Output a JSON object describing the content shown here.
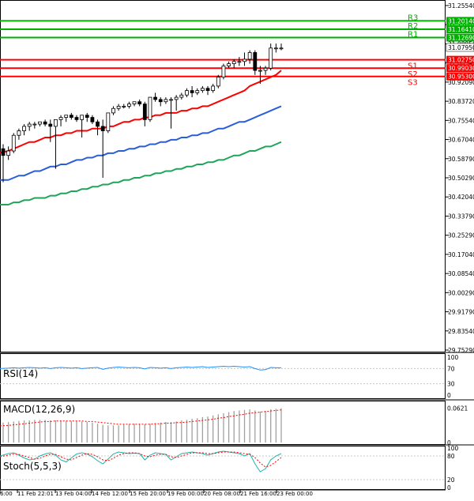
{
  "chart_data": [
    {
      "type": "candlestick",
      "panel": "price",
      "ylim": [
        29.73,
        31.27
      ],
      "y_ticks": [
        "31.25540",
        "31.17040",
        "31.08850",
        "31.00340",
        "30.92090",
        "30.83720",
        "30.75540",
        "30.67040",
        "30.58790",
        "30.50290",
        "30.42040",
        "30.33790",
        "30.25290",
        "30.17040",
        "30.08540",
        "30.00290",
        "29.91790",
        "29.83540",
        "29.75290"
      ],
      "x_ticks": [
        "6:00",
        "11 Feb 22:01",
        "13 Feb 04:00",
        "14 Feb 12:00",
        "15 Feb 20:00",
        "19 Feb 00:00",
        "20 Feb 08:00",
        "21 Feb 16:00",
        "23 Feb 00:00"
      ],
      "current_price": "31.07950",
      "levels": [
        {
          "name": "R3",
          "value": 31.2014,
          "label": "31.20140",
          "color": "#00b000"
        },
        {
          "name": "R2",
          "value": 31.1641,
          "label": "31.16410",
          "color": "#00b000"
        },
        {
          "name": "R1",
          "value": 31.1269,
          "label": "31.12690",
          "color": "#00b000"
        },
        {
          "name": "S1",
          "value": 31.0275,
          "label": "31.02750",
          "color": "#ff0000"
        },
        {
          "name": "S2",
          "value": 30.9903,
          "label": "30.99030",
          "color": "#ff0000"
        },
        {
          "name": "S3",
          "value": 30.953,
          "label": "30.95300",
          "color": "#ff0000"
        }
      ],
      "candles": [
        [
          30.63,
          30.65,
          30.48,
          30.6
        ],
        [
          30.6,
          30.64,
          30.58,
          30.62
        ],
        [
          30.62,
          30.7,
          30.61,
          30.69
        ],
        [
          30.69,
          30.72,
          30.67,
          30.71
        ],
        [
          30.71,
          30.74,
          30.69,
          30.73
        ],
        [
          30.73,
          30.75,
          30.71,
          30.74
        ],
        [
          30.74,
          30.75,
          30.72,
          30.74
        ],
        [
          30.74,
          30.75,
          30.73,
          30.75
        ],
        [
          30.75,
          30.76,
          30.73,
          30.74
        ],
        [
          30.74,
          30.76,
          30.66,
          30.73
        ],
        [
          30.73,
          30.76,
          30.54,
          30.76
        ],
        [
          30.76,
          30.78,
          30.73,
          30.77
        ],
        [
          30.77,
          30.78,
          30.75,
          30.78
        ],
        [
          30.78,
          30.79,
          30.76,
          30.77
        ],
        [
          30.77,
          30.78,
          30.75,
          30.76
        ],
        [
          30.76,
          30.78,
          30.68,
          30.78
        ],
        [
          30.78,
          30.79,
          30.75,
          30.77
        ],
        [
          30.77,
          30.78,
          30.74,
          30.75
        ],
        [
          30.75,
          30.76,
          30.69,
          30.73
        ],
        [
          30.73,
          30.76,
          30.5,
          30.71
        ],
        [
          30.71,
          30.79,
          30.7,
          30.79
        ],
        [
          30.79,
          30.82,
          30.78,
          30.81
        ],
        [
          30.81,
          30.83,
          30.8,
          30.82
        ],
        [
          30.82,
          30.83,
          30.81,
          30.82
        ],
        [
          30.82,
          30.84,
          30.81,
          30.83
        ],
        [
          30.83,
          30.84,
          30.82,
          30.84
        ],
        [
          30.84,
          30.85,
          30.82,
          30.83
        ],
        [
          30.83,
          30.84,
          30.73,
          30.76
        ],
        [
          30.76,
          30.86,
          30.75,
          30.86
        ],
        [
          30.86,
          30.88,
          30.84,
          30.85
        ],
        [
          30.85,
          30.86,
          30.82,
          30.84
        ],
        [
          30.84,
          30.86,
          30.83,
          30.85
        ],
        [
          30.85,
          30.86,
          30.72,
          30.85
        ],
        [
          30.85,
          30.87,
          30.8,
          30.86
        ],
        [
          30.86,
          30.88,
          30.85,
          30.87
        ],
        [
          30.87,
          30.9,
          30.86,
          30.89
        ],
        [
          30.89,
          30.91,
          30.86,
          30.88
        ],
        [
          30.88,
          30.9,
          30.87,
          30.89
        ],
        [
          30.89,
          30.91,
          30.88,
          30.9
        ],
        [
          30.9,
          30.91,
          30.87,
          30.89
        ],
        [
          30.89,
          30.92,
          30.88,
          30.91
        ],
        [
          30.91,
          30.96,
          30.9,
          30.95
        ],
        [
          30.95,
          31.01,
          30.94,
          31.0
        ],
        [
          31.0,
          31.02,
          30.99,
          31.01
        ],
        [
          31.01,
          31.03,
          30.99,
          31.02
        ],
        [
          31.02,
          31.04,
          31.0,
          31.02
        ],
        [
          31.02,
          31.06,
          31.0,
          31.03
        ],
        [
          31.03,
          31.07,
          31.01,
          31.06
        ],
        [
          31.06,
          31.07,
          30.96,
          30.98
        ],
        [
          30.98,
          31.0,
          30.92,
          30.98
        ],
        [
          30.98,
          31.0,
          30.96,
          30.99
        ],
        [
          30.99,
          31.1,
          30.98,
          31.08
        ],
        [
          31.08,
          31.1,
          31.06,
          31.08
        ],
        [
          31.08,
          31.1,
          31.07,
          31.08
        ]
      ],
      "ma_red": [
        30.61,
        30.62,
        30.63,
        30.64,
        30.65,
        30.66,
        30.66,
        30.67,
        30.68,
        30.68,
        30.69,
        30.69,
        30.7,
        30.7,
        30.71,
        30.71,
        30.71,
        30.72,
        30.72,
        30.72,
        30.73,
        30.73,
        30.74,
        30.75,
        30.75,
        30.76,
        30.76,
        30.77,
        30.77,
        30.78,
        30.78,
        30.79,
        30.79,
        30.79,
        30.8,
        30.8,
        30.81,
        30.81,
        30.82,
        30.82,
        30.83,
        30.84,
        30.85,
        30.86,
        30.87,
        30.88,
        30.89,
        30.91,
        30.92,
        30.93,
        30.94,
        30.95,
        30.96,
        30.98
      ],
      "ma_blue": [
        30.49,
        30.49,
        30.5,
        30.51,
        30.51,
        30.52,
        30.53,
        30.53,
        30.54,
        30.55,
        30.55,
        30.56,
        30.56,
        30.57,
        30.58,
        30.58,
        30.59,
        30.59,
        30.6,
        30.6,
        30.61,
        30.61,
        30.62,
        30.62,
        30.63,
        30.63,
        30.64,
        30.64,
        30.65,
        30.65,
        30.66,
        30.66,
        30.67,
        30.67,
        30.68,
        30.68,
        30.69,
        30.69,
        30.7,
        30.7,
        30.71,
        30.72,
        30.72,
        30.73,
        30.74,
        30.75,
        30.75,
        30.76,
        30.77,
        30.78,
        30.79,
        30.8,
        30.81,
        30.82
      ],
      "ma_green": [
        30.38,
        30.38,
        30.39,
        30.39,
        30.4,
        30.4,
        30.41,
        30.41,
        30.41,
        30.42,
        30.42,
        30.43,
        30.43,
        30.44,
        30.44,
        30.45,
        30.45,
        30.46,
        30.46,
        30.47,
        30.47,
        30.48,
        30.48,
        30.49,
        30.49,
        30.5,
        30.5,
        30.51,
        30.51,
        30.52,
        30.52,
        30.53,
        30.53,
        30.54,
        30.54,
        30.55,
        30.55,
        30.56,
        30.56,
        30.57,
        30.57,
        30.58,
        30.58,
        30.59,
        30.6,
        30.6,
        30.61,
        30.62,
        30.62,
        30.63,
        30.64,
        30.64,
        30.65,
        30.66
      ]
    },
    {
      "type": "line",
      "panel": "rsi",
      "title": "RSI(14)",
      "ylim": [
        0,
        100
      ],
      "y_ticks": [
        "100",
        "70",
        "30",
        "0"
      ],
      "values": [
        70,
        71,
        72,
        71,
        72,
        73,
        72,
        71,
        72,
        70,
        72,
        73,
        72,
        71,
        72,
        70,
        71,
        72,
        73,
        68,
        71,
        73,
        74,
        73,
        72,
        73,
        72,
        69,
        73,
        72,
        71,
        72,
        70,
        72,
        73,
        74,
        73,
        74,
        75,
        73,
        74,
        75,
        76,
        75,
        76,
        75,
        74,
        75,
        70,
        66,
        67,
        73,
        72,
        72
      ]
    },
    {
      "type": "macd",
      "panel": "macd",
      "title": "MACD(12,26,9)",
      "ylim": [
        0,
        0.07
      ],
      "y_ticks": [
        "0.0621",
        "0"
      ],
      "histogram": [
        0.036,
        0.037,
        0.038,
        0.039,
        0.04,
        0.04,
        0.041,
        0.041,
        0.041,
        0.04,
        0.04,
        0.04,
        0.039,
        0.039,
        0.039,
        0.038,
        0.037,
        0.036,
        0.034,
        0.032,
        0.031,
        0.031,
        0.031,
        0.032,
        0.033,
        0.034,
        0.034,
        0.033,
        0.034,
        0.035,
        0.036,
        0.037,
        0.037,
        0.038,
        0.04,
        0.041,
        0.043,
        0.044,
        0.046,
        0.047,
        0.049,
        0.051,
        0.053,
        0.055,
        0.057,
        0.058,
        0.059,
        0.06,
        0.058,
        0.056,
        0.057,
        0.06,
        0.061,
        0.062
      ],
      "signal": [
        0.03,
        0.031,
        0.032,
        0.033,
        0.034,
        0.035,
        0.036,
        0.037,
        0.038,
        0.038,
        0.039,
        0.039,
        0.039,
        0.039,
        0.039,
        0.039,
        0.038,
        0.038,
        0.037,
        0.036,
        0.035,
        0.034,
        0.033,
        0.033,
        0.033,
        0.033,
        0.033,
        0.033,
        0.033,
        0.034,
        0.034,
        0.035,
        0.035,
        0.036,
        0.036,
        0.037,
        0.038,
        0.039,
        0.04,
        0.041,
        0.042,
        0.044,
        0.045,
        0.047,
        0.048,
        0.05,
        0.051,
        0.053,
        0.054,
        0.055,
        0.056,
        0.057,
        0.058,
        0.059
      ]
    },
    {
      "type": "line",
      "panel": "stoch",
      "title": "Stoch(5,5,3)",
      "ylim": [
        0,
        100
      ],
      "y_ticks": [
        "100",
        "80",
        "20",
        "0"
      ],
      "main": [
        80,
        86,
        88,
        82,
        75,
        70,
        72,
        80,
        85,
        88,
        82,
        70,
        65,
        75,
        85,
        88,
        85,
        78,
        68,
        60,
        72,
        85,
        90,
        88,
        86,
        87,
        86,
        70,
        82,
        88,
        86,
        84,
        70,
        78,
        86,
        88,
        90,
        88,
        86,
        82,
        86,
        90,
        92,
        90,
        88,
        86,
        80,
        86,
        60,
        40,
        48,
        70,
        80,
        86
      ],
      "signal": [
        78,
        82,
        85,
        84,
        80,
        76,
        72,
        74,
        80,
        84,
        84,
        78,
        72,
        70,
        76,
        82,
        86,
        84,
        78,
        70,
        68,
        74,
        82,
        86,
        88,
        88,
        86,
        80,
        78,
        82,
        84,
        84,
        78,
        76,
        80,
        84,
        88,
        88,
        88,
        86,
        86,
        88,
        90,
        90,
        90,
        88,
        86,
        84,
        76,
        62,
        52,
        56,
        66,
        76
      ]
    }
  ]
}
